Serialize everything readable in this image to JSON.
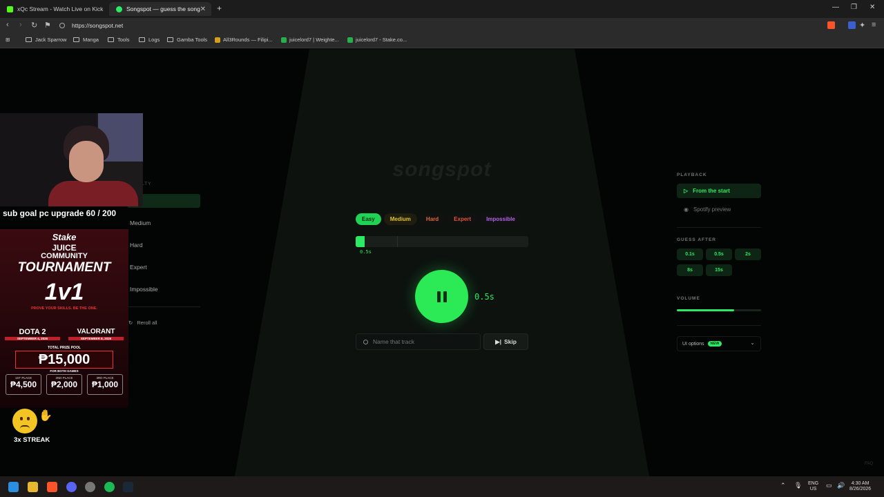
{
  "browser": {
    "tabs": [
      {
        "title": "xQc Stream - Watch Live on Kick",
        "active": false
      },
      {
        "title": "Songspot — guess the song",
        "active": true
      }
    ],
    "url": "https://songspot.net",
    "bookmarks": [
      "Jack Sparrow",
      "Manga",
      "Tools",
      "Logs",
      "Gamba Tools",
      "All3Rounds — Filipi...",
      "juicelord7 | Weighte...",
      "juicelord7 - Stake.co..."
    ]
  },
  "game": {
    "logo": "songspot",
    "difficulties": [
      "Easy",
      "Medium",
      "Hard",
      "Expert",
      "Impossible"
    ],
    "selected_difficulty": "Easy",
    "progress_label": "0.5s",
    "progress_fraction": 0.03,
    "elapsed": "0.5s",
    "search_placeholder": "Name that track",
    "skip_label": "Skip"
  },
  "left_panel": {
    "heading": "LTY",
    "items": [
      "Medium",
      "Hard",
      "Expert",
      "Impossible"
    ],
    "reroll": "Reroll all"
  },
  "right_panel": {
    "playback_heading": "PLAYBACK",
    "playback_options": [
      "From the start",
      "Spotify preview"
    ],
    "guess_after_heading": "GUESS AFTER",
    "guess_after": [
      "0.1s",
      "0.5s",
      "2s",
      "8s",
      "15s"
    ],
    "volume_heading": "VOLUME",
    "volume_fraction": 0.68,
    "ui_options": "UI options",
    "new_badge": "NEW",
    "faq": "FAQ"
  },
  "overlay": {
    "sub_goal": "sub goal pc upgrade 60 / 200",
    "poster": {
      "brand": "Stake",
      "line1": "JUICE",
      "line2": "COMMUNITY",
      "line3": "TOURNAMENT",
      "line4": "1v1",
      "tagline": "PROVE YOUR SKILLS. BE THE ONE.",
      "game1": "DOTA 2",
      "game1_date": "SEPTEMBER 4, 2026",
      "game2": "VALORANT",
      "game2_date": "SEPTEMBER 8, 2026",
      "prize_label": "TOTAL PRIZE POOL",
      "prize": "₱15,000",
      "prize_sub": "FOR BOTH GAMES",
      "places": [
        {
          "place": "1ST PLACE",
          "amount": "₱4,500"
        },
        {
          "place": "2ND PLACE",
          "amount": "₱2,000"
        },
        {
          "place": "3RD PLACE",
          "amount": "₱1,000"
        }
      ]
    },
    "streak": "3x STREAK"
  },
  "taskbar": {
    "lang": "ENG",
    "region": "US",
    "time": "4:30 AM",
    "date": "8/26/2026"
  }
}
